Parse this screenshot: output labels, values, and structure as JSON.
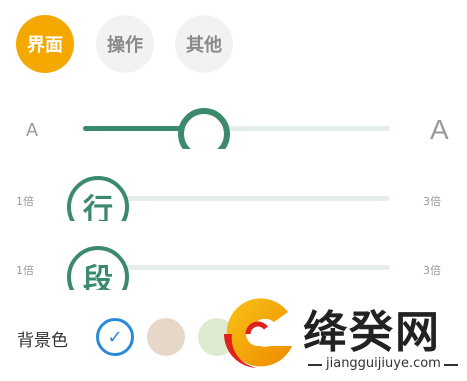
{
  "tabs": [
    {
      "label": "界面",
      "active": true
    },
    {
      "label": "操作",
      "active": false
    },
    {
      "label": "其他",
      "active": false
    }
  ],
  "font_size": {
    "min_label": "A",
    "max_label": "A",
    "value_fraction": 0.39
  },
  "line_spacing": {
    "glyph": "行",
    "min_label": "1倍",
    "max_label": "3倍",
    "value_fraction": 0.0
  },
  "paragraph_spacing": {
    "glyph": "段",
    "min_label": "1倍",
    "max_label": "3倍",
    "value_fraction": 0.0
  },
  "background": {
    "label": "背景色",
    "check_glyph": "✓",
    "swatches": [
      "#ffffff",
      "#e7d7c9",
      "#dcebd0"
    ],
    "selected_index": 0
  },
  "colors": {
    "accent": "#f5a800",
    "slider": "#3a8a6b",
    "selection": "#2a8ad8"
  },
  "watermark": {
    "title": "绛癸网",
    "subtitle": "jiangguijiuye.com"
  }
}
